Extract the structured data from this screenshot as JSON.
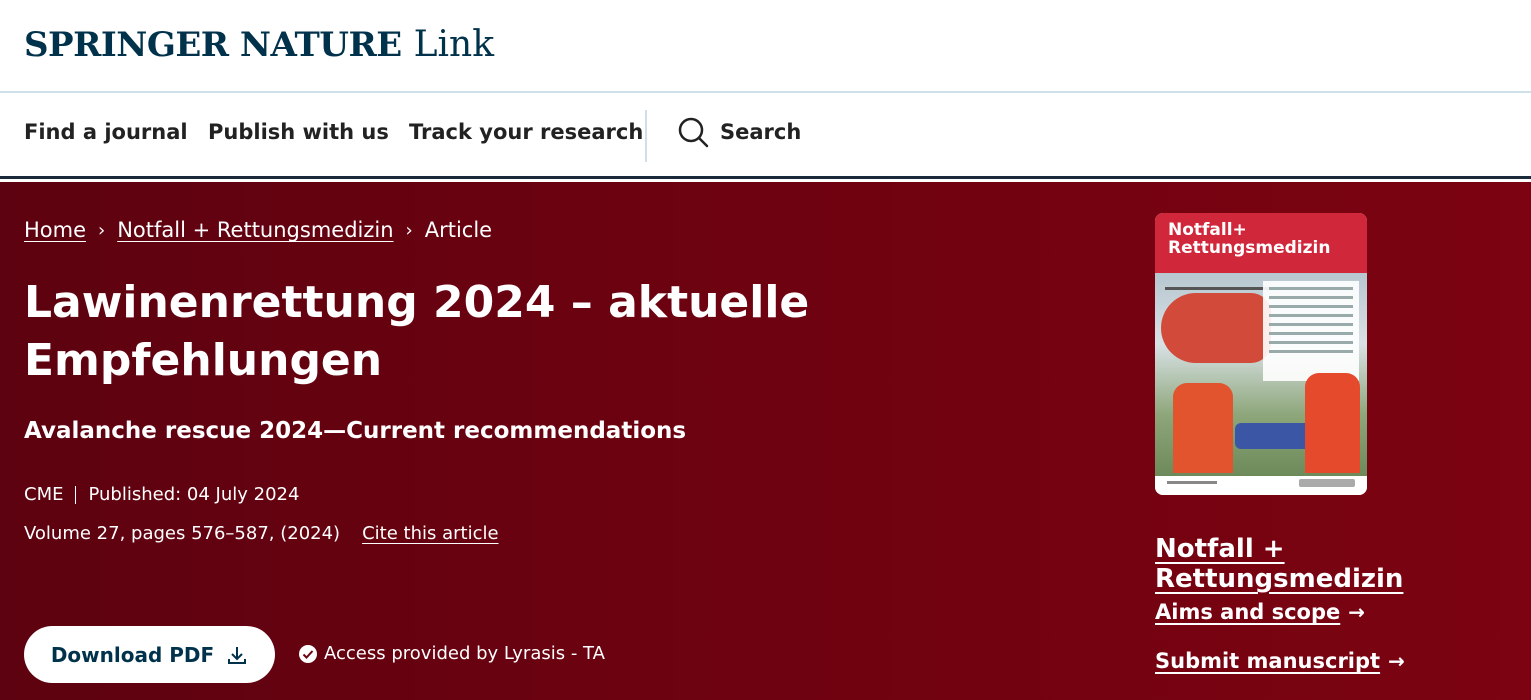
{
  "header": {
    "brand_main": "SPRINGER NATURE",
    "brand_sub": "Link"
  },
  "nav": {
    "items": [
      {
        "label": "Find a journal"
      },
      {
        "label": "Publish with us"
      },
      {
        "label": "Track your research"
      }
    ],
    "search_label": "Search"
  },
  "breadcrumb": {
    "home": "Home",
    "journal": "Notfall + Rettungsmedizin",
    "current": "Article"
  },
  "article": {
    "title": "Lawinenrettung 2024 – aktuelle Empfehlungen",
    "subtitle": "Avalanche rescue 2024—Current recommendations",
    "type": "CME",
    "published": "Published: 04 July 2024",
    "volume_pages": "Volume 27, pages 576–587, (2024)",
    "cite_label": "Cite this article"
  },
  "actions": {
    "download_label": "Download PDF",
    "access_text": "Access provided by Lyrasis - TA"
  },
  "cover": {
    "title_line1": "Notfall+",
    "title_line2": "Rettungsmedizin"
  },
  "sidebar": {
    "journal_name": "Notfall + Rettungsmedizin",
    "aims_label": "Aims and scope",
    "submit_label": "Submit manuscript"
  },
  "colors": {
    "brand": "#01324b",
    "hero_bg": "#6d0210",
    "cover_red": "#d0273b"
  }
}
